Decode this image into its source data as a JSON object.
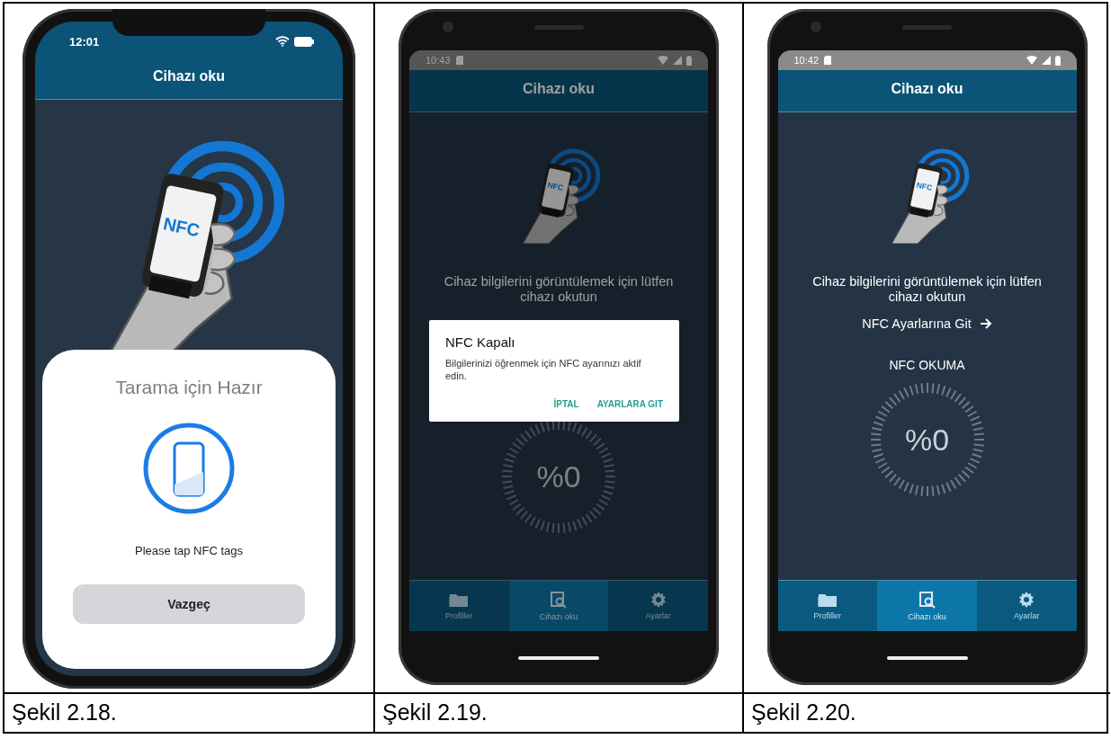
{
  "figures": [
    {
      "kind": "ios_sheet",
      "caption": "Şekil 2.18.",
      "status_time": "12:01",
      "title": "Cihazı oku",
      "illustration_text": "NFC",
      "sheet": {
        "title": "Tarama için Hazır",
        "message": "Please tap NFC tags",
        "button": "Vazgeç"
      }
    },
    {
      "kind": "android",
      "caption": "Şekil 2.19.",
      "status_time": "10:43",
      "title": "Cihazı oku",
      "illustration_text": "NFC",
      "prompt": "Cihaz bilgilerini görüntülemek için lütfen cihazı okutun",
      "gauge": {
        "reading": "%0"
      },
      "dialog": {
        "title": "NFC Kapalı",
        "message": "Bilgilerinizi öğrenmek için NFC ayarınızı aktif edin.",
        "buttons": [
          "İPTAL",
          "AYARLARA GIT"
        ]
      },
      "tabs": [
        {
          "label": "Profiller",
          "selected": false
        },
        {
          "label": "Cihazı oku",
          "selected": true
        },
        {
          "label": "Ayarlar",
          "selected": false
        }
      ]
    },
    {
      "kind": "android",
      "caption": "Şekil 2.20.",
      "status_time": "10:42",
      "title": "Cihazı oku",
      "illustration_text": "NFC",
      "prompt": "Cihaz bilgilerini görüntülemek için lütfen cihazı okutun",
      "settings_link": "NFC Ayarlarına Git",
      "gauge": {
        "title": "NFC OKUMA",
        "reading": "%0"
      },
      "tabs": [
        {
          "label": "Profiller",
          "selected": false
        },
        {
          "label": "Cihazı oku",
          "selected": true
        },
        {
          "label": "Ayarlar",
          "selected": false
        }
      ]
    }
  ]
}
